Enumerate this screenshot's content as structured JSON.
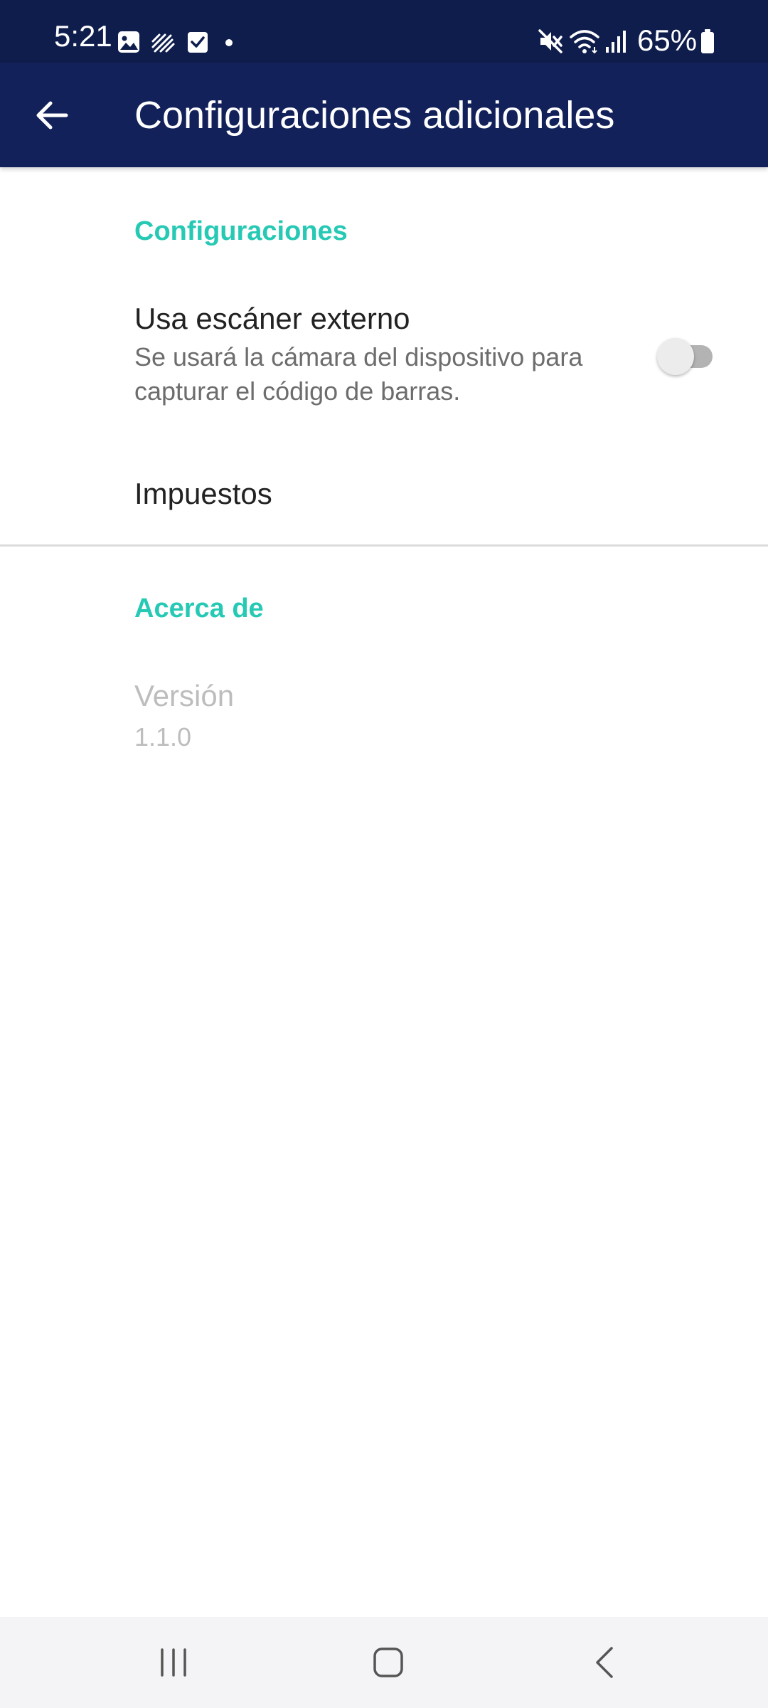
{
  "status_bar": {
    "time": "5:21",
    "battery_percent": "65%",
    "left_icons": [
      "image-icon",
      "signal-lines-icon",
      "checkbox-icon",
      "dot-icon"
    ],
    "right_icons": [
      "mute-icon",
      "wifi-icon",
      "cell-signal-icon",
      "battery-icon"
    ]
  },
  "app_bar": {
    "title": "Configuraciones adicionales",
    "back_icon": "arrow-back-icon"
  },
  "sections": {
    "settings": {
      "header": "Configuraciones",
      "external_scanner": {
        "title": "Usa escáner externo",
        "summary": "Se usará la cámara del dispositivo para capturar el código de barras.",
        "enabled": false
      },
      "taxes": {
        "title": "Impuestos"
      }
    },
    "about": {
      "header": "Acerca de",
      "version": {
        "title": "Versión",
        "value": "1.1.0"
      }
    }
  },
  "nav_bar": {
    "buttons": [
      "recent-apps-icon",
      "home-icon",
      "back-icon"
    ]
  },
  "colors": {
    "status_bar": "#0f1d4d",
    "app_bar": "#13215a",
    "accent": "#26c9b4",
    "divider": "#dcdcdc",
    "disabled_text": "#bdbdbd"
  }
}
